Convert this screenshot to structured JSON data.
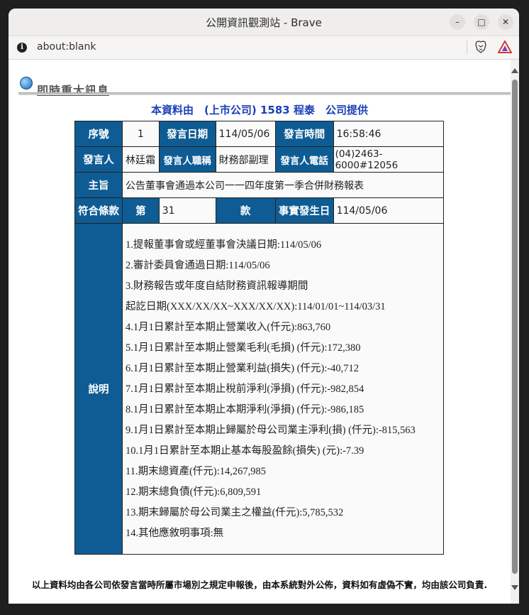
{
  "window": {
    "title": "公開資訊觀測站 - Brave",
    "minimize": "–",
    "maximize": "□",
    "close": "✕"
  },
  "address_bar": {
    "url": "about:blank",
    "info_icon": "i"
  },
  "page": {
    "section_title": "即時重大訊息",
    "source_line": "本資料由　(上市公司) 1583 程泰　公司提供",
    "table": {
      "row1": {
        "seq_label": "序號",
        "seq_value": "1",
        "date_label": "發言日期",
        "date_value": "114/05/06",
        "time_label": "發言時間",
        "time_value": "16:58:46"
      },
      "row2": {
        "speaker_label": "發言人",
        "speaker_value": "林廷霜",
        "title_label": "發言人職稱",
        "title_value": "財務部副理",
        "phone_label": "發言人電話",
        "phone_value": "(04)2463-6000#12056"
      },
      "row3": {
        "subject_label": "主旨",
        "subject_value": "公告董事會通過本公司一一四年度第一季合併財務報表"
      },
      "row4": {
        "clause_label": "符合條款",
        "clause_pre": "第",
        "clause_value": "31",
        "clause_post": "款",
        "fact_date_label": "事實發生日",
        "fact_date_value": "114/05/06"
      },
      "row5": {
        "desc_label": "說明",
        "lines": [
          "1.提報董事會或經董事會決議日期:114/05/06",
          "2.審計委員會通過日期:114/05/06",
          "3.財務報告或年度自結財務資訊報導期間",
          "起訖日期(XXX/XX/XX~XXX/XX/XX):114/01/01~114/03/31",
          "4.1月1日累計至本期止營業收入(仟元):863,760",
          "5.1月1日累計至本期止營業毛利(毛損) (仟元):172,380",
          "6.1月1日累計至本期止營業利益(損失) (仟元):-40,712",
          "7.1月1日累計至本期止稅前淨利(淨損) (仟元):-982,854",
          "8.1月1日累計至本期止本期淨利(淨損) (仟元):-986,185",
          "9.1月1日累計至本期止歸屬於母公司業主淨利(損) (仟元):-815,563",
          "10.1月1日累計至本期止基本每股盈餘(損失) (元):-7.39",
          "11.期末總資產(仟元):14,267,985",
          "12.期末總負債(仟元):6,809,591",
          "13.期末歸屬於母公司業主之權益(仟元):5,785,532",
          "14.其他應敘明事項:無"
        ]
      }
    },
    "footer": "以上資料均由各公司依發言當時所屬市場別之規定申報後，由本系統對外公佈，資料如有虛偽不實，均由該公司負責."
  }
}
